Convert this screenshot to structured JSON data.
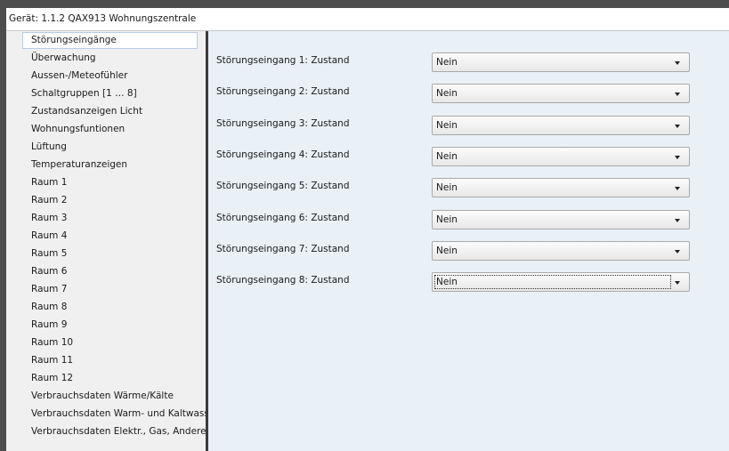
{
  "window": {
    "title": "Gerät: 1.1.2  QAX913 Wohnungszentrale"
  },
  "sidebar": {
    "items": [
      {
        "label": "Störungseingänge",
        "selected": true
      },
      {
        "label": "Überwachung"
      },
      {
        "label": "Aussen-/Meteofühler"
      },
      {
        "label": "Schaltgruppen [1 … 8]"
      },
      {
        "label": "Zustandsanzeigen Licht"
      },
      {
        "label": "Wohnungsfuntionen"
      },
      {
        "label": "Lüftung"
      },
      {
        "label": "Temperaturanzeigen"
      },
      {
        "label": "Raum 1"
      },
      {
        "label": "Raum 2"
      },
      {
        "label": "Raum 3"
      },
      {
        "label": "Raum 4"
      },
      {
        "label": "Raum 5"
      },
      {
        "label": "Raum 6"
      },
      {
        "label": "Raum 7"
      },
      {
        "label": "Raum 8"
      },
      {
        "label": "Raum 9"
      },
      {
        "label": "Raum 10"
      },
      {
        "label": "Raum 11"
      },
      {
        "label": "Raum 12"
      },
      {
        "label": "Verbrauchsdaten Wärme/Kälte"
      },
      {
        "label": "Verbrauchsdaten Warm- und Kaltwass"
      },
      {
        "label": "Verbrauchsdaten Elektr., Gas, Andere"
      }
    ]
  },
  "main": {
    "fields": [
      {
        "label": "Störungseingang 1: Zustand",
        "value": "Nein"
      },
      {
        "label": "Störungseingang 2: Zustand",
        "value": "Nein"
      },
      {
        "label": "Störungseingang 3: Zustand",
        "value": "Nein"
      },
      {
        "label": "Störungseingang 4: Zustand",
        "value": "Nein"
      },
      {
        "label": "Störungseingang 5: Zustand",
        "value": "Nein"
      },
      {
        "label": "Störungseingang 6: Zustand",
        "value": "Nein"
      },
      {
        "label": "Störungseingang 7: Zustand",
        "value": "Nein"
      },
      {
        "label": "Störungseingang 8: Zustand",
        "value": "Nein",
        "focused": true
      }
    ],
    "dropdown_icon": "chevron-down-icon"
  },
  "colors": {
    "sidebar_bg": "#f0f0f0",
    "main_bg": "#e9f1f7",
    "frame": "#4d4d4d"
  }
}
